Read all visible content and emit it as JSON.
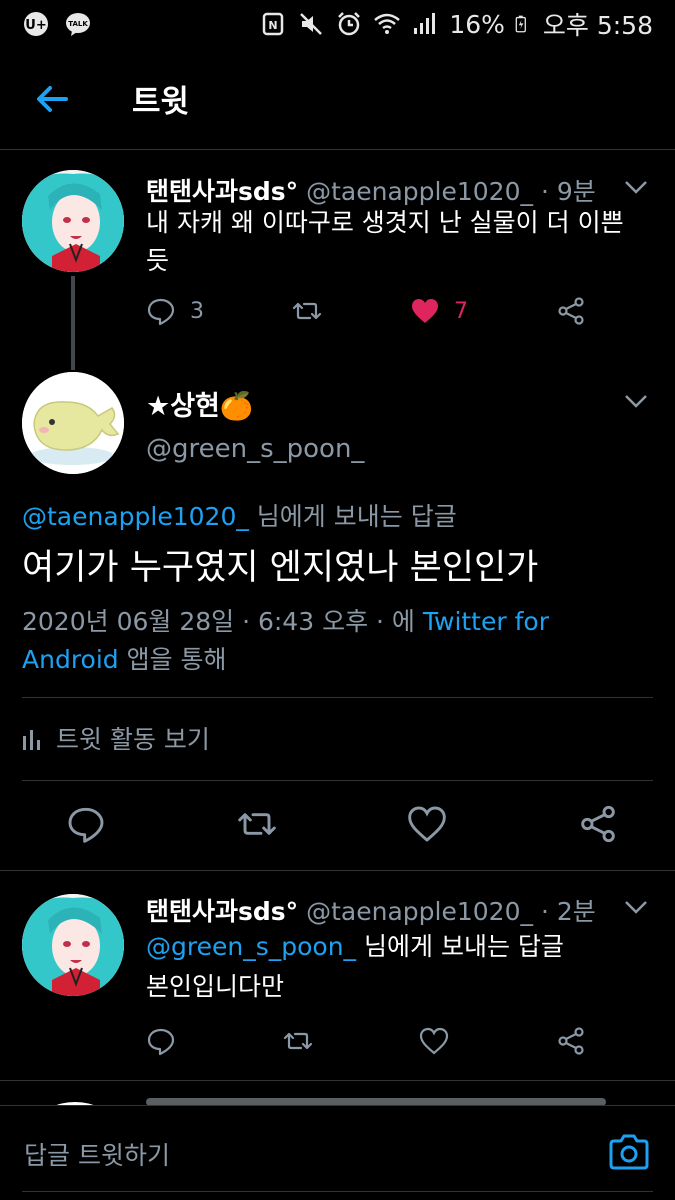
{
  "status_bar": {
    "battery": "16%",
    "time": "오후 5:58",
    "talk_label": "TALK"
  },
  "header": {
    "title": "트윗"
  },
  "tweet1": {
    "name": "탠탠사과sds°",
    "handle": "@taenapple1020_",
    "time": "· 9분",
    "text": "내 자캐 왜 이따구로 생겻지 난 실물이 더 이쁜듯",
    "replies": "3",
    "likes": "7"
  },
  "main_tweet": {
    "name": "★상현🍊",
    "handle": "@green_s_poon_",
    "reply_to_handle": "@taenapple1020_",
    "reply_to_suffix": " 님에게 보내는 답글",
    "text": "여기가 누구였지 엔지였나 본인인가",
    "date": "2020년 06월 28일 · 6:43 오후 · 에 ",
    "source": "Twitter for Android",
    "via": " 앱을 통해",
    "activity": "트윗 활동 보기"
  },
  "tweet3": {
    "name": "탠탠사과sds°",
    "handle": "@taenapple1020_",
    "time": "· 2분",
    "reply_to_handle": "@green_s_poon_",
    "reply_to_suffix": " 님에게 보내는 답글",
    "text": "본인입니다만"
  },
  "compose": {
    "placeholder": "답글 트윗하기"
  },
  "colors": {
    "accent": "#1da1f2",
    "like": "#e0245e",
    "muted": "#8b98a5",
    "background": "#000000"
  }
}
